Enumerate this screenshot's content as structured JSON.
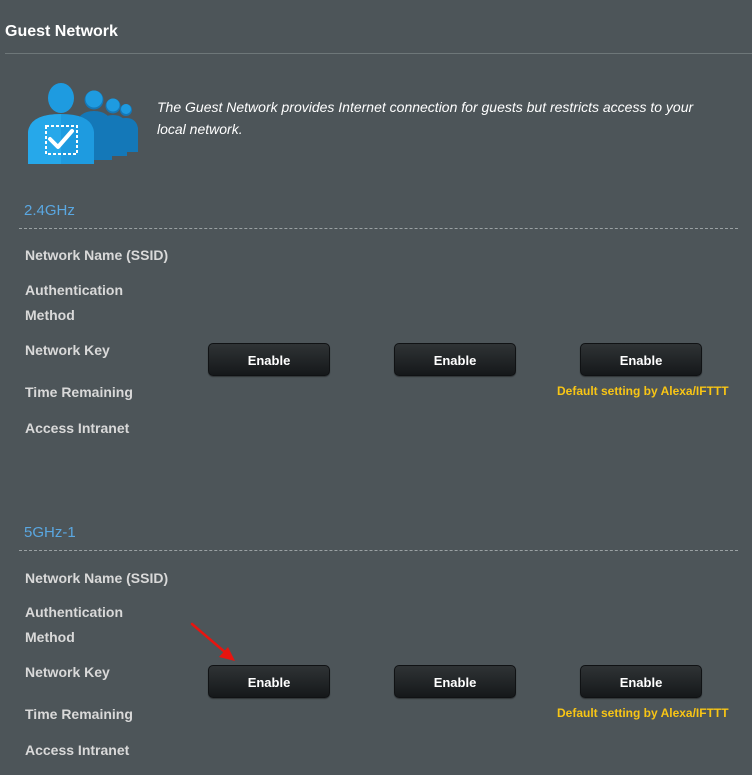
{
  "page": {
    "title": "Guest Network"
  },
  "intro": {
    "icon": "guest-users-icon",
    "text": "The Guest Network provides Internet connection for guests but restricts access to your local network."
  },
  "bands": [
    {
      "name": "2.4GHz",
      "fields": [
        "Network Name (SSID)",
        "Authentication Method",
        "Network Key",
        "Time Remaining",
        "Access Intranet"
      ],
      "buttons": [
        "Enable",
        "Enable",
        "Enable"
      ],
      "note": "Default setting by Alexa/IFTTT"
    },
    {
      "name": "5GHz-1",
      "fields": [
        "Network Name (SSID)",
        "Authentication Method",
        "Network Key",
        "Time Remaining",
        "Access Intranet"
      ],
      "buttons": [
        "Enable",
        "Enable",
        "Enable"
      ],
      "note": "Default setting by Alexa/IFTTT"
    }
  ],
  "annotation": {
    "icon": "red-arrow-icon"
  },
  "colors": {
    "background": "#4d5559",
    "band_title": "#5aa7e1",
    "note": "#f8c515",
    "accent_icon": "#1e9be0"
  }
}
